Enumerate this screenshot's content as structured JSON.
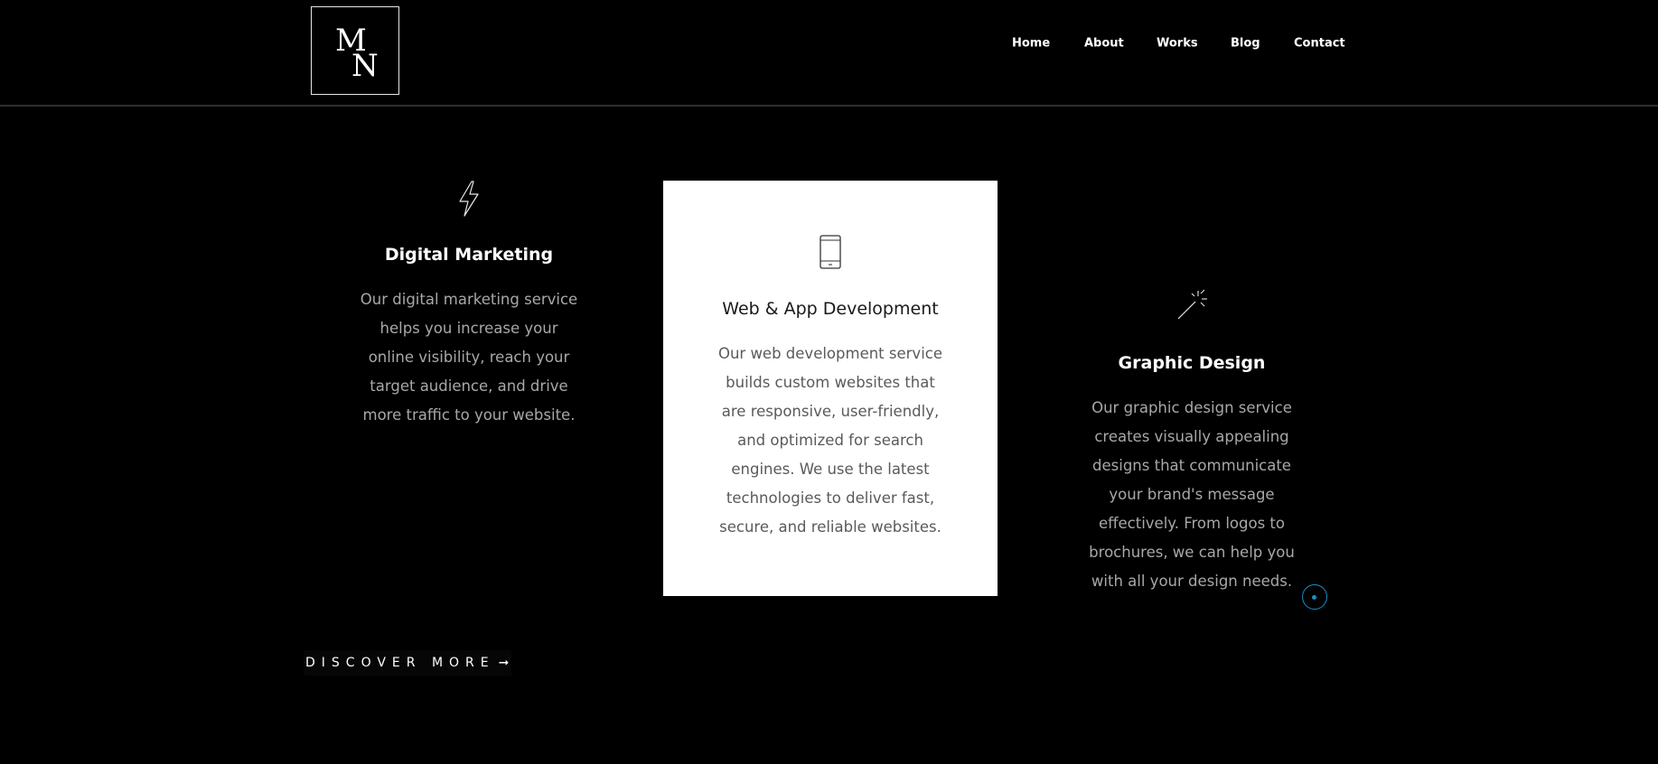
{
  "logo": {
    "letter_1": "M",
    "letter_2": "N"
  },
  "nav": {
    "items": [
      "Home",
      "About",
      "Works",
      "Blog",
      "Contact"
    ]
  },
  "services": [
    {
      "icon": "lightning-bolt-icon",
      "title": "Digital Marketing",
      "description": "Our digital marketing service helps you increase your online visibility, reach your target audience, and drive more traffic to your website."
    },
    {
      "icon": "smartphone-icon",
      "title": "Web & App Development",
      "description": "Our web development service builds custom websites that are responsive, user-friendly, and optimized for search engines. We use the latest technologies to deliver fast, secure, and reliable websites."
    },
    {
      "icon": "magic-wand-icon",
      "title": "Graphic Design",
      "description": "Our graphic design service creates visually appealing designs that communicate your brand's message effectively. From logos to brochures, we can help you with all your design needs."
    }
  ],
  "cta": {
    "label": "DISCOVER MORE",
    "arrow": "➞"
  },
  "colors": {
    "background": "#000000",
    "highlight_card": "#ffffff",
    "accent": "#1a8fc9",
    "muted_text": "#a8a8a8"
  }
}
